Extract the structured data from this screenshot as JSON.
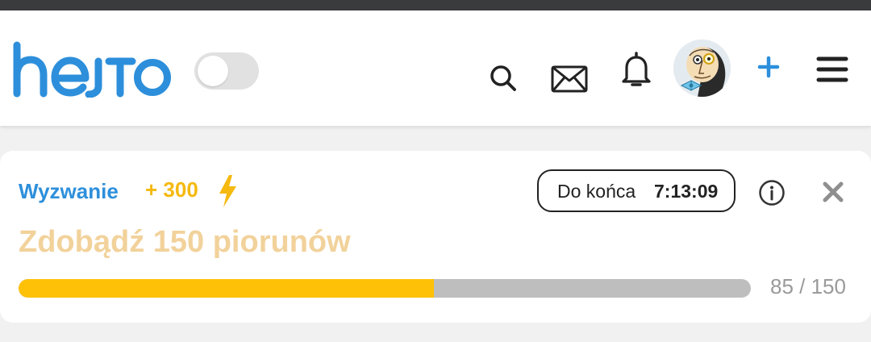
{
  "app": {
    "logo_text": "hejto",
    "accent_color": "#2d8fdb"
  },
  "header": {
    "theme_toggle": {
      "state": "off"
    },
    "icons": [
      "search-icon",
      "mail-icon",
      "bell-icon",
      "avatar",
      "plus-icon",
      "menu-icon"
    ],
    "plus_label": "+"
  },
  "challenge": {
    "label": "Wyzwanie",
    "points": "+ 300",
    "points_icon": "lightning-icon",
    "timer_label": "Do końca",
    "timer_value": "7:13:09",
    "title": "Zdobądź 150 piorunów",
    "progress": {
      "current": 85,
      "total": 150,
      "text": "85 / 150"
    },
    "colors": {
      "label": "#2d8fdb",
      "points": "#f5b90f",
      "title": "#f2d29b",
      "bar_fill": "#ffc107",
      "bar_track": "#bebebe"
    }
  }
}
